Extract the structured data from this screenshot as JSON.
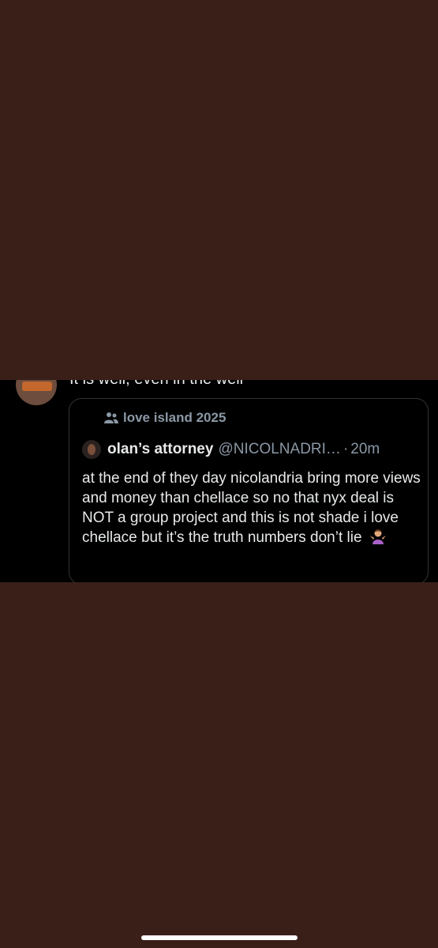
{
  "parent_tweet": {
    "text": "It is well, even in the well"
  },
  "quote": {
    "community_name": "love island 2025",
    "author_name": "olan’s attorney",
    "author_handle": "@NICOLNADRI…",
    "separator": "·",
    "time": "20m",
    "text": "at the end of they day nicolandria bring more views and money than chellace so no that nyx deal is NOT a group project and this is not shade i love chellace but it’s the truth numbers don’t lie"
  },
  "icons": {
    "community": "community-icon",
    "emoji": "person-shrugging-emoji"
  },
  "colors": {
    "background": "#3a1f19",
    "strip": "#000000",
    "text": "#e7e9ea",
    "muted": "#8b98a5"
  }
}
